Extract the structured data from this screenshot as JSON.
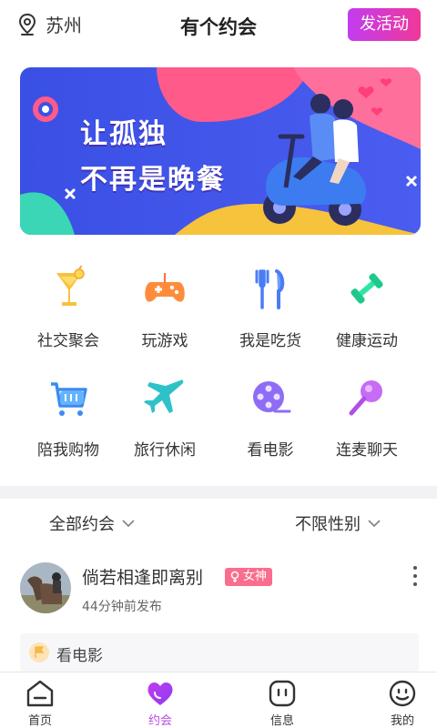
{
  "header": {
    "location": "苏州",
    "title": "有个约会",
    "post_button": "发活动"
  },
  "banner": {
    "line1": "让孤独",
    "line2": "不再是晚餐"
  },
  "categories": [
    {
      "label": "社交聚会",
      "icon": "cocktail-icon"
    },
    {
      "label": "玩游戏",
      "icon": "gamepad-icon"
    },
    {
      "label": "我是吃货",
      "icon": "fork-knife-icon"
    },
    {
      "label": "健康运动",
      "icon": "dumbbell-icon"
    },
    {
      "label": "陪我购物",
      "icon": "shopping-cart-icon"
    },
    {
      "label": "旅行休闲",
      "icon": "airplane-icon"
    },
    {
      "label": "看电影",
      "icon": "film-reel-icon"
    },
    {
      "label": "连麦聊天",
      "icon": "microphone-icon"
    }
  ],
  "filters": {
    "type": "全部约会",
    "gender": "不限性别"
  },
  "post": {
    "name": "倘若相逢即离别",
    "badge": "女神",
    "time": "44分钟前发布",
    "activity": "看电影"
  },
  "nav": {
    "tabs": [
      {
        "label": "首页",
        "icon": "home-icon",
        "active": false
      },
      {
        "label": "约会",
        "icon": "heart-icon",
        "active": true
      },
      {
        "label": "信息",
        "icon": "message-icon",
        "active": false
      },
      {
        "label": "我的",
        "icon": "smiley-icon",
        "active": false
      }
    ]
  },
  "colors": {
    "accent": "#b84be2",
    "post_gradient_start": "#c13cf0",
    "post_gradient_end": "#f0389a",
    "badge": "#fb6d8d",
    "banner_blue": "#3f55e6",
    "banner_pink": "#ff5a8a"
  }
}
